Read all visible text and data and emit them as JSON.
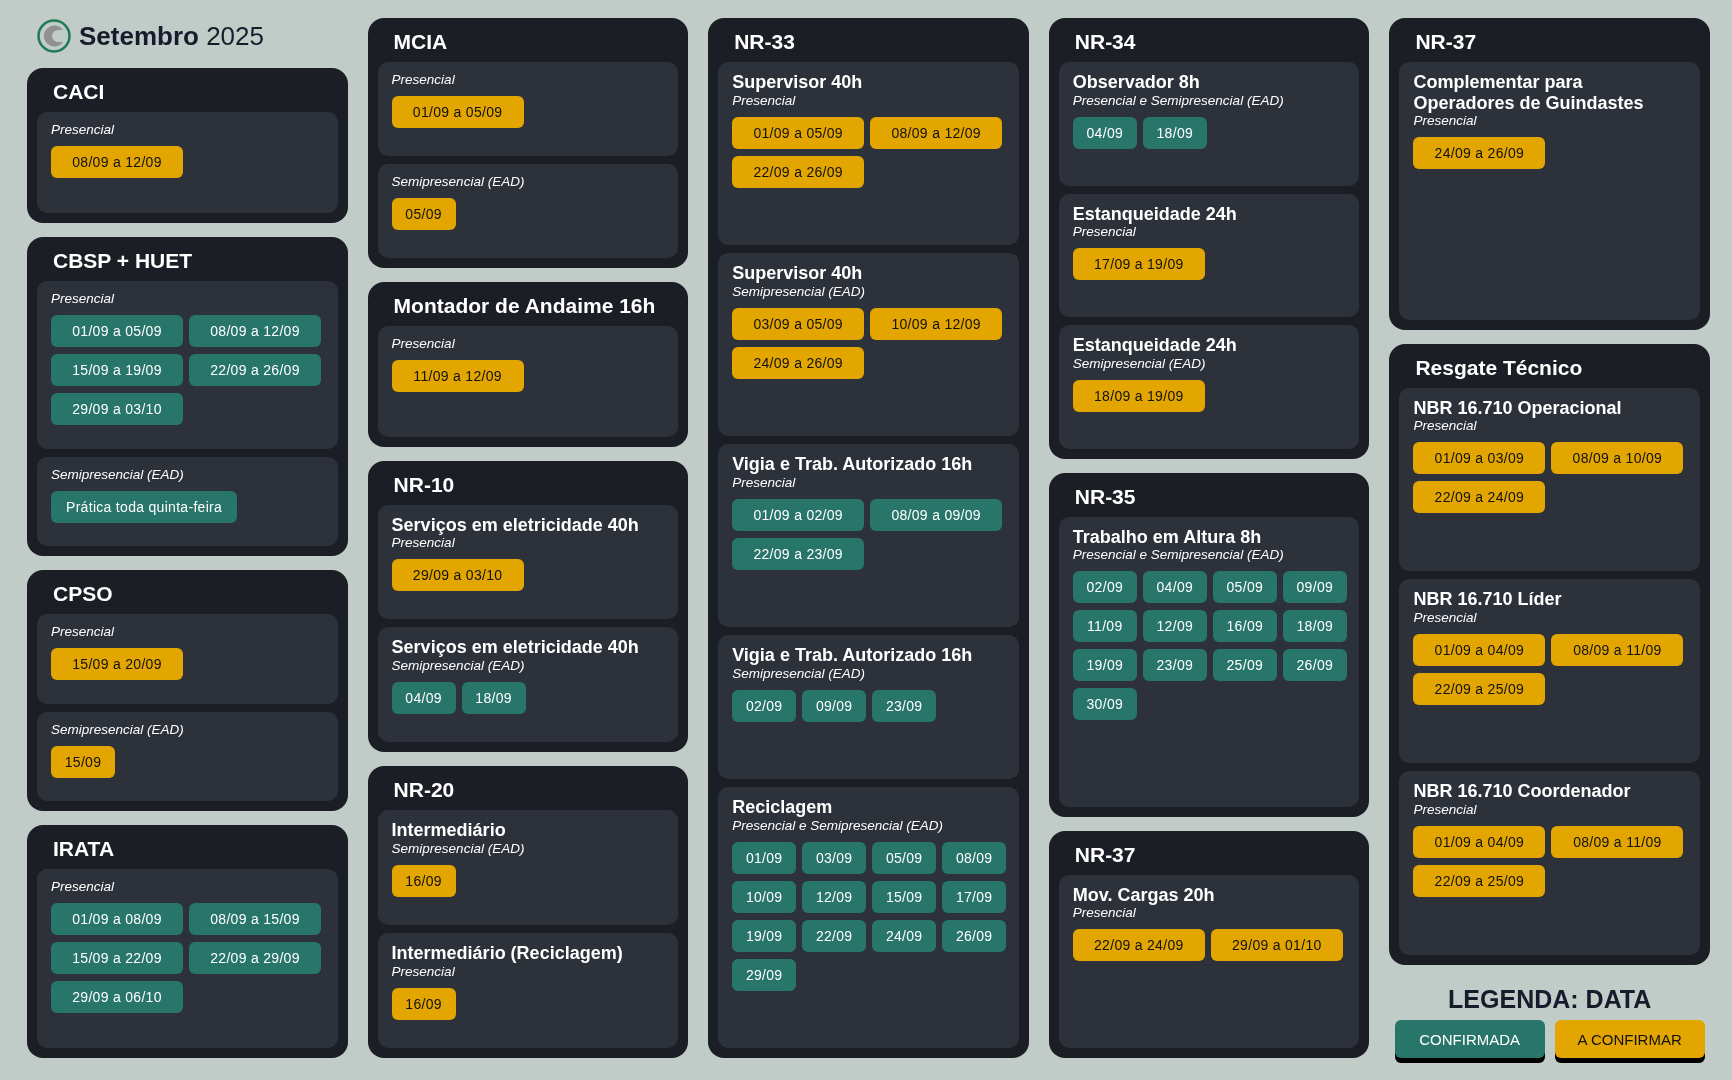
{
  "header": {
    "title": "**Setembro** 2025"
  },
  "columns": [
    {
      "cards": [
        {
          "title": "CACI",
          "blocks": [
            {
              "mode": "Presencial",
              "dates": [
                {
                  "text": "08/09 a 12/09",
                  "confirmed": false
                }
              ]
            }
          ]
        },
        {
          "title": "CBSP + HUET",
          "blocks": [
            {
              "mode": "Presencial",
              "dates": [
                {
                  "text": "01/09 a 05/09",
                  "confirmed": true
                },
                {
                  "text": "08/09 a 12/09",
                  "confirmed": true
                },
                {
                  "text": "15/09 a 19/09",
                  "confirmed": true
                },
                {
                  "text": "22/09 a 26/09",
                  "confirmed": true
                },
                {
                  "text": "29/09 a 03/10",
                  "confirmed": true
                }
              ]
            },
            {
              "mode": "Semipresencial (EAD)",
              "dates": [
                {
                  "text": "Prática toda quinta-feira",
                  "confirmed": true
                }
              ]
            }
          ]
        },
        {
          "title": "CPSO",
          "blocks": [
            {
              "mode": "Presencial",
              "dates": [
                {
                  "text": "15/09 a 20/09",
                  "confirmed": false
                }
              ]
            },
            {
              "mode": "Semipresencial (EAD)",
              "dates": [
                {
                  "text": "15/09",
                  "confirmed": false
                }
              ]
            }
          ]
        },
        {
          "title": "IRATA",
          "blocks": [
            {
              "mode": "Presencial",
              "dates": [
                {
                  "text": "01/09 a 08/09",
                  "confirmed": true
                },
                {
                  "text": "08/09 a 15/09",
                  "confirmed": true
                },
                {
                  "text": "15/09 a 22/09",
                  "confirmed": true
                },
                {
                  "text": "22/09 a 29/09",
                  "confirmed": true
                },
                {
                  "text": "29/09 a 06/10",
                  "confirmed": true
                }
              ]
            }
          ]
        }
      ]
    },
    {
      "cards": [
        {
          "title": "MCIA",
          "blocks": [
            {
              "mode": "Presencial",
              "dates": [
                {
                  "text": "01/09 a 05/09",
                  "confirmed": false
                }
              ]
            },
            {
              "mode": "Semipresencial (EAD)",
              "dates": [
                {
                  "text": "05/09",
                  "confirmed": false
                }
              ]
            }
          ]
        },
        {
          "title": "Montador de Andaime 16h",
          "blocks": [
            {
              "mode": "Presencial",
              "dates": [
                {
                  "text": "11/09 a 12/09",
                  "confirmed": false
                }
              ]
            }
          ]
        },
        {
          "title": "NR-10",
          "blocks": [
            {
              "name": "Serviços em eletricidade 40h",
              "mode": "Presencial",
              "dates": [
                {
                  "text": "29/09 a 03/10",
                  "confirmed": false
                }
              ]
            },
            {
              "name": "Serviços em eletricidade 40h",
              "mode": "Semipresencial (EAD)",
              "dates": [
                {
                  "text": "04/09",
                  "confirmed": true
                },
                {
                  "text": "18/09",
                  "confirmed": true
                }
              ]
            }
          ]
        },
        {
          "title": "NR-20",
          "blocks": [
            {
              "name": "Intermediário",
              "mode": "Semipresencial (EAD)",
              "dates": [
                {
                  "text": "16/09",
                  "confirmed": false
                }
              ]
            },
            {
              "name": "Intermediário (Reciclagem)",
              "mode": "Presencial",
              "dates": [
                {
                  "text": "16/09",
                  "confirmed": false
                }
              ]
            }
          ]
        }
      ]
    },
    {
      "cards": [
        {
          "title": "NR-33",
          "blocks": [
            {
              "name": "Supervisor 40h",
              "mode": "Presencial",
              "dates": [
                {
                  "text": "01/09 a 05/09",
                  "confirmed": false
                },
                {
                  "text": "08/09 a 12/09",
                  "confirmed": false
                },
                {
                  "text": "22/09 a 26/09",
                  "confirmed": false
                }
              ]
            },
            {
              "name": "Supervisor 40h",
              "mode": "Semipresencial (EAD)",
              "dates": [
                {
                  "text": "03/09 a 05/09",
                  "confirmed": false
                },
                {
                  "text": "10/09 a 12/09",
                  "confirmed": false
                },
                {
                  "text": "24/09 a 26/09",
                  "confirmed": false
                }
              ]
            },
            {
              "name": "Vigia e Trab. Autorizado 16h",
              "mode": "Presencial",
              "dates": [
                {
                  "text": "01/09 a 02/09",
                  "confirmed": true
                },
                {
                  "text": "08/09 a 09/09",
                  "confirmed": true
                },
                {
                  "text": "22/09 a 23/09",
                  "confirmed": true
                }
              ]
            },
            {
              "name": "Vigia e Trab. Autorizado 16h",
              "mode": "Semipresencial (EAD)",
              "dates": [
                {
                  "text": "02/09",
                  "confirmed": true
                },
                {
                  "text": "09/09",
                  "confirmed": true
                },
                {
                  "text": "23/09",
                  "confirmed": true
                }
              ]
            },
            {
              "name": "Reciclagem",
              "mode": "Presencial e Semipresencial (EAD)",
              "dates": [
                {
                  "text": "01/09",
                  "confirmed": true
                },
                {
                  "text": "03/09",
                  "confirmed": true
                },
                {
                  "text": "05/09",
                  "confirmed": true
                },
                {
                  "text": "08/09",
                  "confirmed": true
                },
                {
                  "text": "10/09",
                  "confirmed": true
                },
                {
                  "text": "12/09",
                  "confirmed": true
                },
                {
                  "text": "15/09",
                  "confirmed": true
                },
                {
                  "text": "17/09",
                  "confirmed": true
                },
                {
                  "text": "19/09",
                  "confirmed": true
                },
                {
                  "text": "22/09",
                  "confirmed": true
                },
                {
                  "text": "24/09",
                  "confirmed": true
                },
                {
                  "text": "26/09",
                  "confirmed": true
                },
                {
                  "text": "29/09",
                  "confirmed": true
                }
              ]
            }
          ]
        }
      ]
    },
    {
      "cards": [
        {
          "title": "NR-34",
          "blocks": [
            {
              "name": "Observador 8h",
              "mode": "Presencial e Semipresencial (EAD)",
              "dates": [
                {
                  "text": "04/09",
                  "confirmed": true
                },
                {
                  "text": "18/09",
                  "confirmed": true
                }
              ]
            },
            {
              "name": "Estanqueidade 24h",
              "mode": "Presencial",
              "dates": [
                {
                  "text": "17/09 a 19/09",
                  "confirmed": false
                }
              ]
            },
            {
              "name": "Estanqueidade 24h",
              "mode": "Semipresencial (EAD)",
              "dates": [
                {
                  "text": "18/09 a 19/09",
                  "confirmed": false
                }
              ]
            }
          ]
        },
        {
          "title": "NR-35",
          "blocks": [
            {
              "name": "Trabalho em Altura 8h",
              "mode": "Presencial e Semipresencial (EAD)",
              "dates": [
                {
                  "text": "02/09",
                  "confirmed": true
                },
                {
                  "text": "04/09",
                  "confirmed": true
                },
                {
                  "text": "05/09",
                  "confirmed": true
                },
                {
                  "text": "09/09",
                  "confirmed": true
                },
                {
                  "text": "11/09",
                  "confirmed": true
                },
                {
                  "text": "12/09",
                  "confirmed": true
                },
                {
                  "text": "16/09",
                  "confirmed": true
                },
                {
                  "text": "18/09",
                  "confirmed": true
                },
                {
                  "text": "19/09",
                  "confirmed": true
                },
                {
                  "text": "23/09",
                  "confirmed": true
                },
                {
                  "text": "25/09",
                  "confirmed": true
                },
                {
                  "text": "26/09",
                  "confirmed": true
                },
                {
                  "text": "30/09",
                  "confirmed": true
                }
              ]
            }
          ]
        },
        {
          "title": "NR-37",
          "blocks": [
            {
              "name": "Mov. Cargas  20h",
              "mode": "Presencial",
              "dates": [
                {
                  "text": "22/09 a 24/09",
                  "confirmed": false
                },
                {
                  "text": "29/09 a 01/10",
                  "confirmed": false
                }
              ]
            }
          ]
        }
      ]
    },
    {
      "cards": [
        {
          "title": "NR-37",
          "blocks": [
            {
              "name": "Complementar para Operadores de Guindastes",
              "mode": "Presencial",
              "dates": [
                {
                  "text": "24/09 a 26/09",
                  "confirmed": false
                }
              ]
            }
          ]
        },
        {
          "title": "Resgate Técnico",
          "blocks": [
            {
              "name": "NBR 16.710 Operacional",
              "mode": "Presencial",
              "dates": [
                {
                  "text": "01/09 a 03/09",
                  "confirmed": false
                },
                {
                  "text": "08/09 a 10/09",
                  "confirmed": false
                },
                {
                  "text": "22/09 a 24/09",
                  "confirmed": false
                }
              ]
            },
            {
              "name": "NBR 16.710 Líder",
              "mode": "Presencial",
              "dates": [
                {
                  "text": "01/09 a 04/09",
                  "confirmed": false
                },
                {
                  "text": "08/09 a 11/09",
                  "confirmed": false
                },
                {
                  "text": "22/09 a 25/09",
                  "confirmed": false
                }
              ]
            },
            {
              "name": "NBR 16.710 Coordenador",
              "mode": "Presencial",
              "dates": [
                {
                  "text": "01/09 a 04/09",
                  "confirmed": false
                },
                {
                  "text": "08/09 a 11/09",
                  "confirmed": false
                },
                {
                  "text": "22/09 a 25/09",
                  "confirmed": false
                }
              ]
            }
          ]
        }
      ]
    }
  ],
  "legend": {
    "title": "LEGENDA: DATA",
    "items": [
      {
        "label": "CONFIRMADA",
        "confirmed": true
      },
      {
        "label": "A CONFIRMAR",
        "confirmed": false
      }
    ]
  }
}
